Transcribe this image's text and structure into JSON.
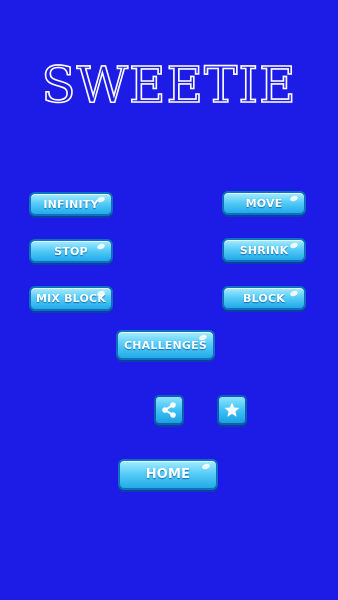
{
  "title": "SWEETIE",
  "buttons": {
    "infinity": "INFINITY",
    "move": "MOVE",
    "stop": "STOP",
    "shrink": "SHRINK",
    "mix_block": "MIX BLOCK",
    "block": "BLOCK",
    "challenges": "CHALLENGES",
    "home": "HOME"
  },
  "icons": {
    "share": "share-icon",
    "star": "star-icon"
  },
  "colors": {
    "background": "#1d1ce6",
    "button": "#4fc8f6",
    "text": "#ffffff"
  }
}
